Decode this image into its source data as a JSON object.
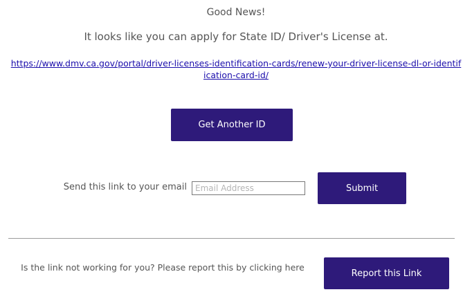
{
  "result": {
    "headline": "Good News!",
    "message": "It looks like you can apply for State ID/ Driver's License at.",
    "link_url": "https://www.dmv.ca.gov/portal/driver-licenses-identification-cards/renew-your-driver-license-dl-or-identification-card-id/"
  },
  "actions": {
    "get_another_label": "Get Another ID"
  },
  "email_form": {
    "label": "Send this link to your email",
    "placeholder": "Email Address",
    "value": "",
    "submit_label": "Submit"
  },
  "report": {
    "text": "Is the link not working for you? Please report this by clicking here",
    "button_label": "Report this Link"
  },
  "colors": {
    "button_bg": "#2e1a7a",
    "link": "#1a0dab",
    "text": "#555555"
  }
}
